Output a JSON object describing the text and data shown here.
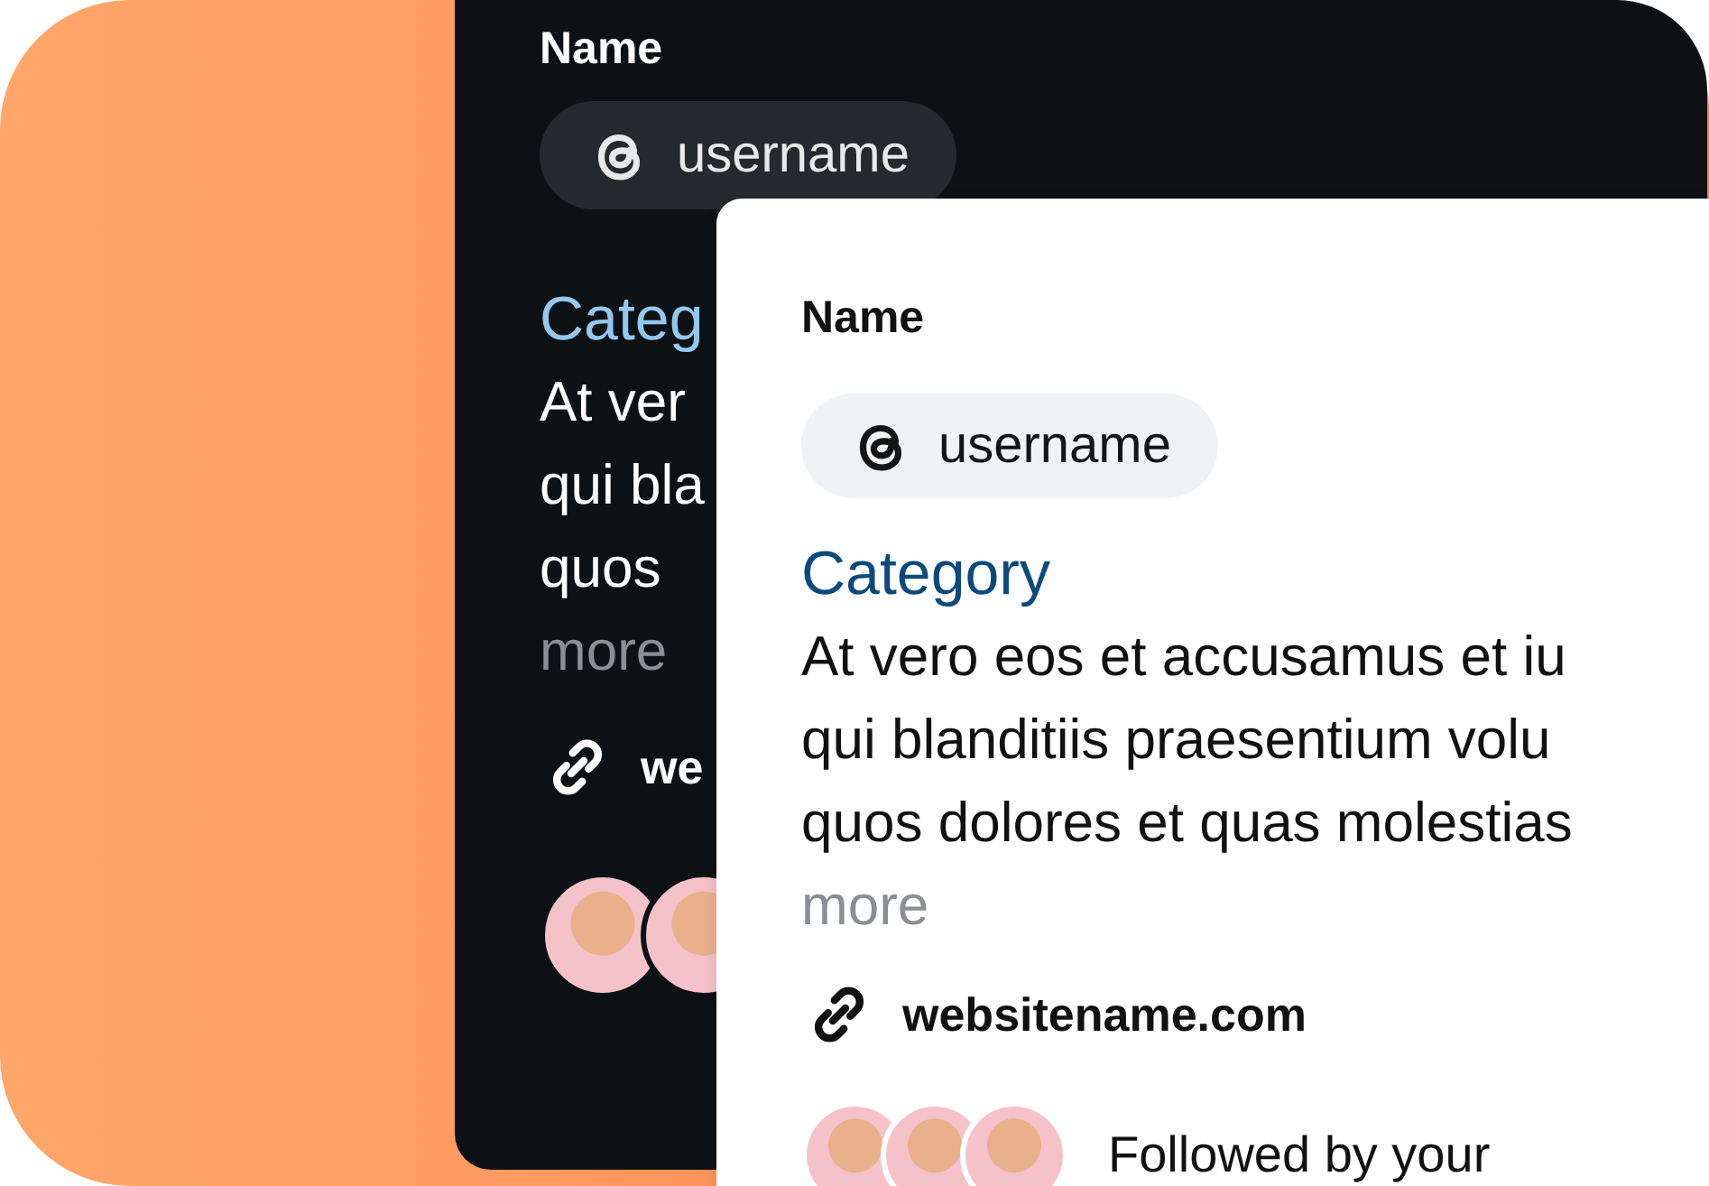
{
  "back_card": {
    "name": "Name",
    "username": "username",
    "category": "Categ",
    "bio_lines": [
      "At ver",
      "qui bla",
      "quos"
    ],
    "more": "more",
    "website": "we",
    "avatars": [
      {
        "kind": "avatar"
      },
      {
        "kind": "avatar"
      }
    ]
  },
  "front_card": {
    "name": "Name",
    "username": "username",
    "category": "Category",
    "bio_lines": [
      "At vero eos et accusamus et iu",
      "qui blanditiis praesentium volu",
      "quos dolores et quas molestias"
    ],
    "more": "more",
    "website": "websitename.com",
    "avatars": [
      {
        "kind": "avatar"
      },
      {
        "kind": "avatar"
      },
      {
        "kind": "avatar"
      }
    ],
    "followed_by": "Followed by your"
  }
}
